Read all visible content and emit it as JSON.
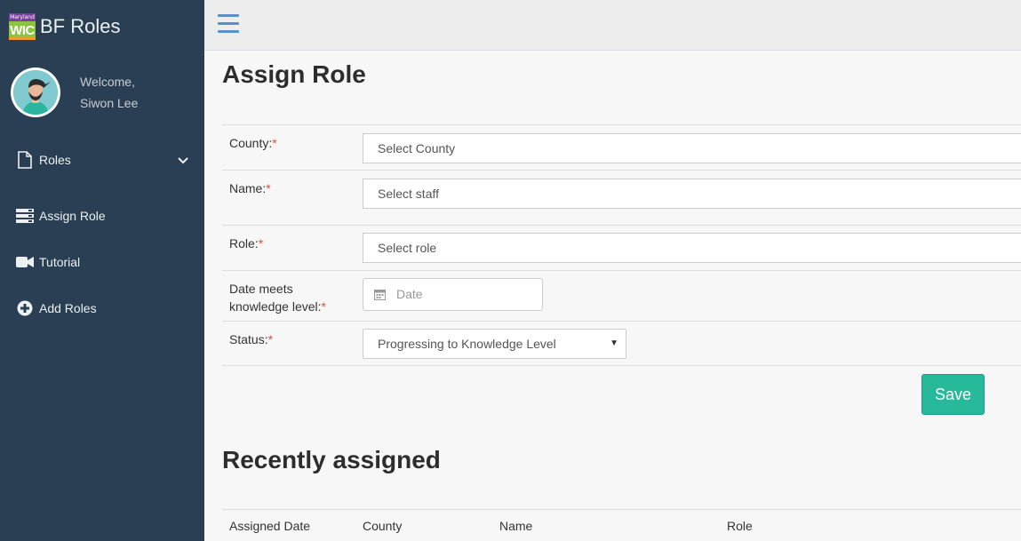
{
  "brand": {
    "logo_top": "Maryland",
    "logo_bottom": "WIC",
    "title": "BF Roles"
  },
  "profile": {
    "welcome": "Welcome,",
    "name": "Siwon Lee"
  },
  "sidebar": {
    "items": [
      {
        "label": "Roles",
        "icon": "file-icon"
      },
      {
        "label": "Assign Role",
        "icon": "server-icon"
      },
      {
        "label": "Tutorial",
        "icon": "video-camera-icon"
      },
      {
        "label": "Add Roles",
        "icon": "plus-circle-icon"
      }
    ]
  },
  "main": {
    "title": "Assign Role",
    "form": {
      "county": {
        "label": "County:",
        "required": "*",
        "value": "Select County"
      },
      "name": {
        "label": "Name:",
        "required": "*",
        "value": "Select staff"
      },
      "role": {
        "label": "Role:",
        "required": "*",
        "value": "Select role"
      },
      "date": {
        "label_line1": "Date meets",
        "label_line2": "knowledge level:",
        "required": "*",
        "placeholder": "Date"
      },
      "status": {
        "label": "Status:",
        "required": "*",
        "value": "Progressing to Knowledge Level"
      },
      "save_label": "Save"
    },
    "recent": {
      "title": "Recently assigned",
      "columns": [
        "Assigned Date",
        "County",
        "Name",
        "Role"
      ]
    }
  },
  "colors": {
    "sidebar": "#2a3f54",
    "accent": "#26b99a",
    "required": "#e74c3c",
    "menu_icon": "#5a738e"
  }
}
